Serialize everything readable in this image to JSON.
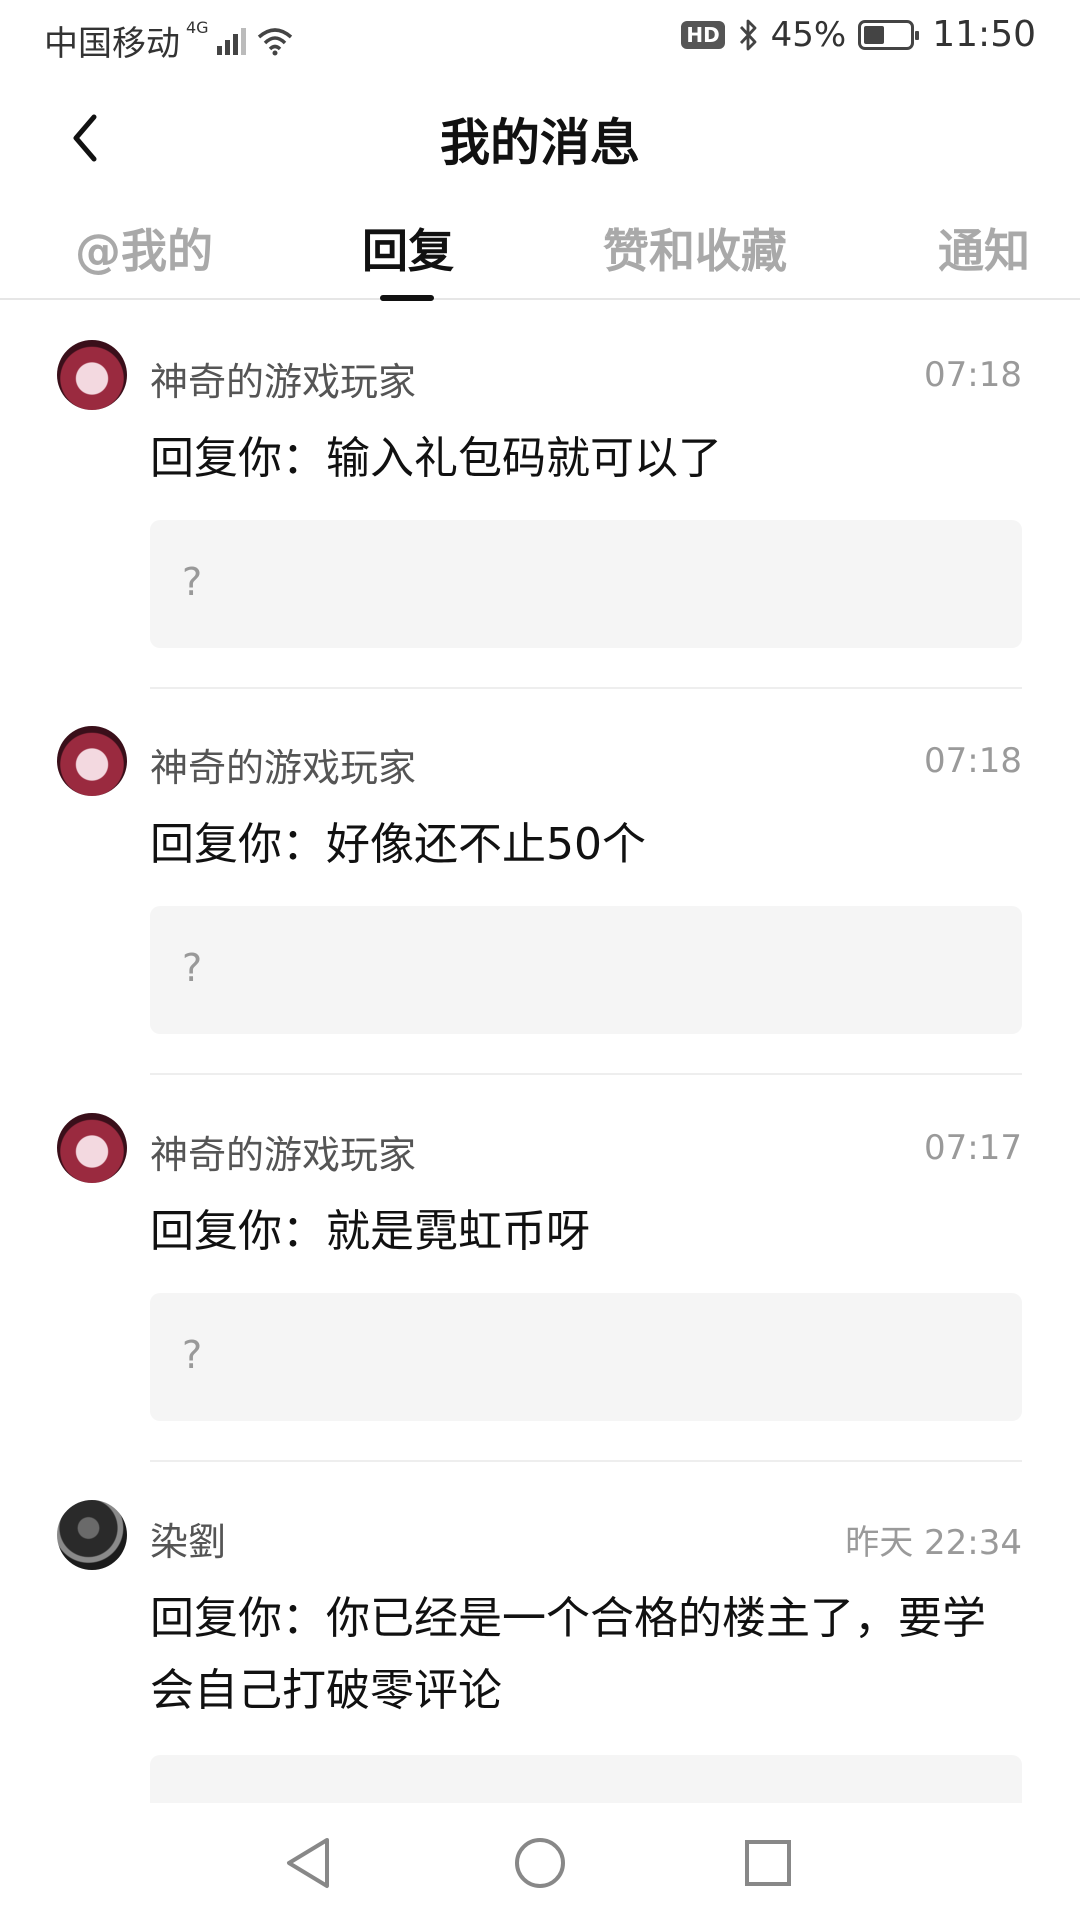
{
  "status_bar": {
    "carrier": "中国移动",
    "network": "4G",
    "hd": "HD",
    "battery_percent": "45%",
    "battery_level": 0.45,
    "time": "11:50"
  },
  "header": {
    "title": "我的消息"
  },
  "tabs": [
    {
      "label": "@我的",
      "active": false
    },
    {
      "label": "回复",
      "active": true
    },
    {
      "label": "赞和收藏",
      "active": false
    },
    {
      "label": "通知",
      "active": false
    }
  ],
  "messages": [
    {
      "username": "神奇的游戏玩家",
      "time": "07:18",
      "reply": "回复你：输入礼包码就可以了",
      "quote": "?"
    },
    {
      "username": "神奇的游戏玩家",
      "time": "07:18",
      "reply": "回复你：好像还不止50个",
      "quote": "?"
    },
    {
      "username": "神奇的游戏玩家",
      "time": "07:17",
      "reply": "回复你：就是霓虹币呀",
      "quote": "?"
    },
    {
      "username": "染劉",
      "time": "昨天 22:34",
      "reply": "回复你：你已经是一个合格的楼主了，要学会自己打破零评论",
      "quote": ""
    }
  ],
  "icons": {
    "back": "chevron-left-icon",
    "nav_back": "triangle-back-icon",
    "nav_home": "circle-home-icon",
    "nav_recent": "square-recent-icon"
  }
}
